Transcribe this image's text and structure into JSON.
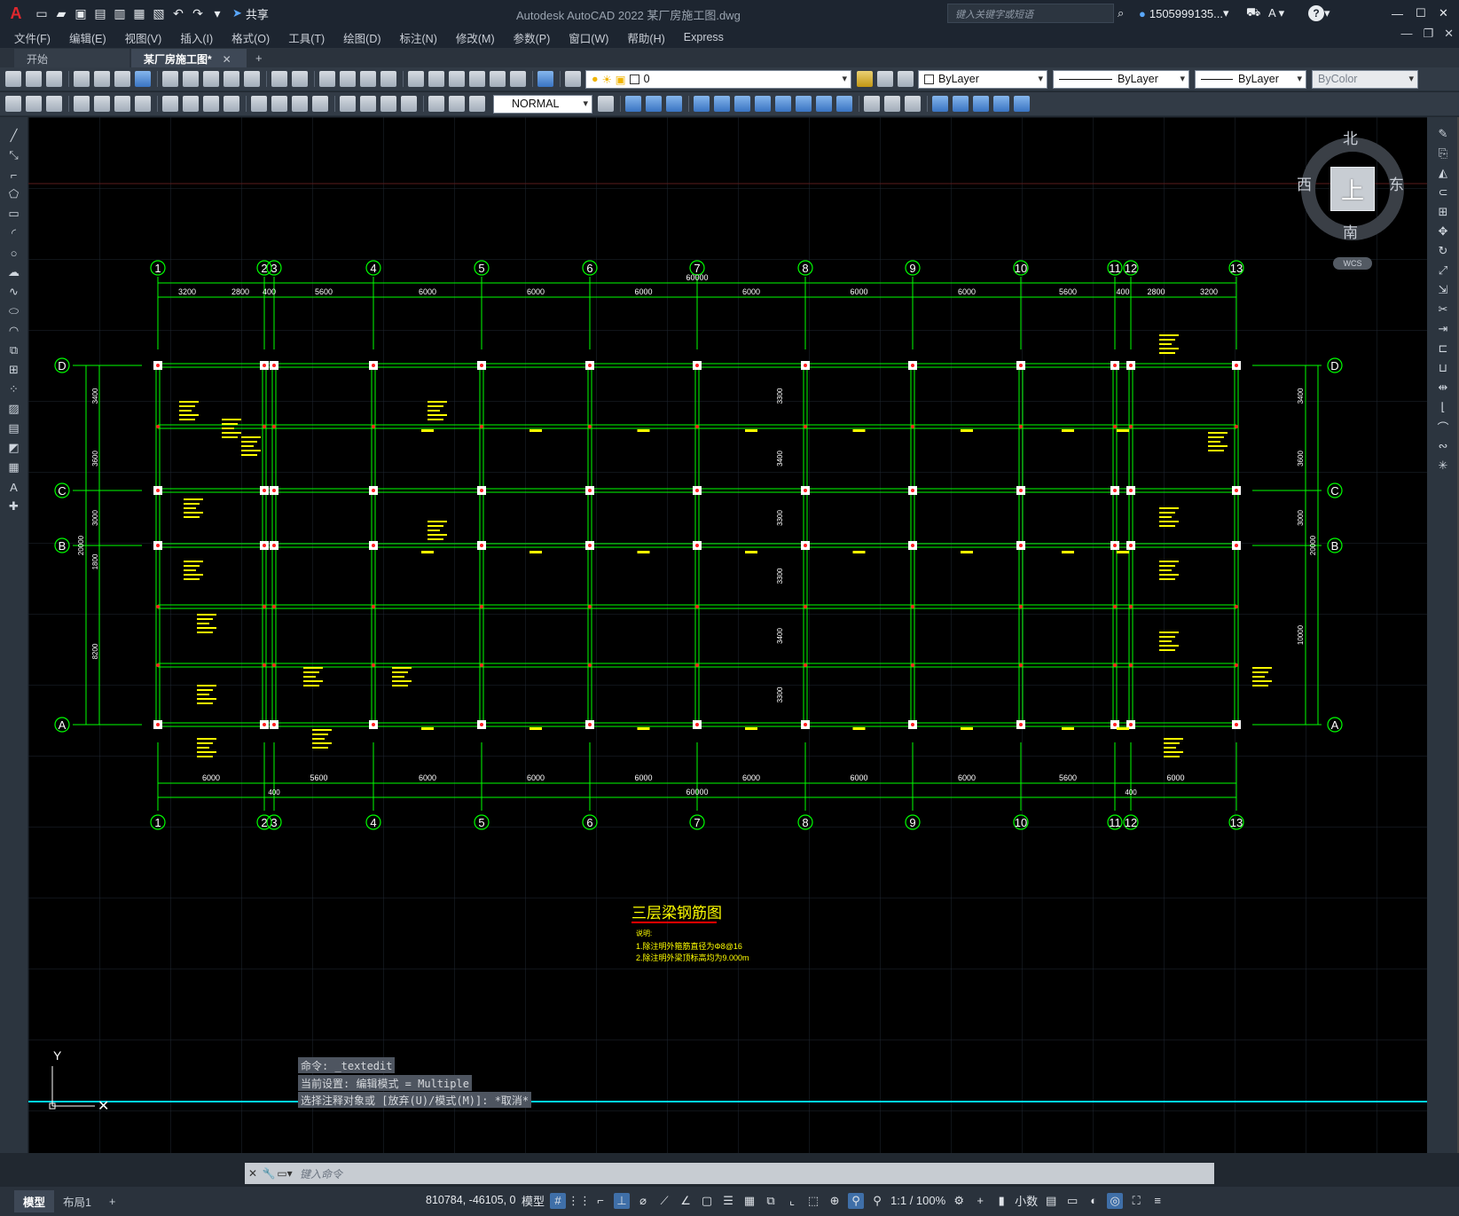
{
  "app": {
    "title": "Autodesk AutoCAD 2022    某厂房施工图.dwg",
    "logo": "A",
    "share_label": "共享",
    "search_placeholder": "键入关键字或短语",
    "user": "1505999135...",
    "help": "?"
  },
  "menu": [
    "文件(F)",
    "编辑(E)",
    "视图(V)",
    "插入(I)",
    "格式(O)",
    "工具(T)",
    "绘图(D)",
    "标注(N)",
    "修改(M)",
    "参数(P)",
    "窗口(W)",
    "帮助(H)",
    "Express"
  ],
  "tabs": [
    {
      "label": "开始"
    },
    {
      "label": "某厂房施工图*"
    }
  ],
  "toolbar": {
    "layer_value": "0",
    "color_value": "ByLayer",
    "linetype_value": "ByLayer",
    "lineweight_value": "ByLayer",
    "plotstyle_value": "ByColor",
    "dimstyle_value": "NORMAL"
  },
  "viewcube": {
    "north": "北",
    "south": "南",
    "east": "东",
    "west": "西",
    "face": "上",
    "wcs": "WCS"
  },
  "drawing": {
    "grid_top_labels": [
      "1",
      "2",
      "3",
      "4",
      "5",
      "6",
      "7",
      "8",
      "9",
      "10",
      "11",
      "12",
      "13"
    ],
    "row_labels": [
      "D",
      "C",
      "B",
      "A"
    ],
    "top_dims": [
      "3200",
      "2800",
      "400",
      "5600",
      "6000",
      "6000",
      "6000",
      "6000",
      "6000",
      "6000",
      "5600",
      "400",
      "2800",
      "3200"
    ],
    "top_total": "60000",
    "bottom_dims": [
      "6000",
      "5600",
      "6000",
      "6000",
      "6000",
      "6000",
      "6000",
      "6000",
      "5600",
      "6000"
    ],
    "bottom_small": "400",
    "bottom_total": "60000",
    "left_dims": [
      "3400",
      "3600",
      "3000",
      "1800",
      "8200"
    ],
    "left_total": "20000",
    "right_dims": [
      "3400",
      "3600",
      "3000",
      "10000"
    ],
    "right_total": "20000",
    "mid_dims": [
      "3300",
      "3400",
      "3300",
      "3300",
      "3400",
      "3300"
    ],
    "plan_title": "三层梁钢筋图",
    "notes_heading": "说明:",
    "notes": [
      "1.除注明外箍筋直径为Φ8@16",
      "2.除注明外梁顶标高均为9.000m"
    ]
  },
  "command": {
    "history": [
      "命令: _textedit",
      "当前设置: 编辑模式 = Multiple",
      "选择注释对象或 [放弃(U)/模式(M)]: *取消*"
    ],
    "placeholder": "键入命令"
  },
  "status": {
    "tabs": [
      "模型",
      "布局1"
    ],
    "coords": "810784, -46105, 0",
    "model_label": "模型",
    "scale": "1:1 / 100%",
    "units": "小数"
  }
}
